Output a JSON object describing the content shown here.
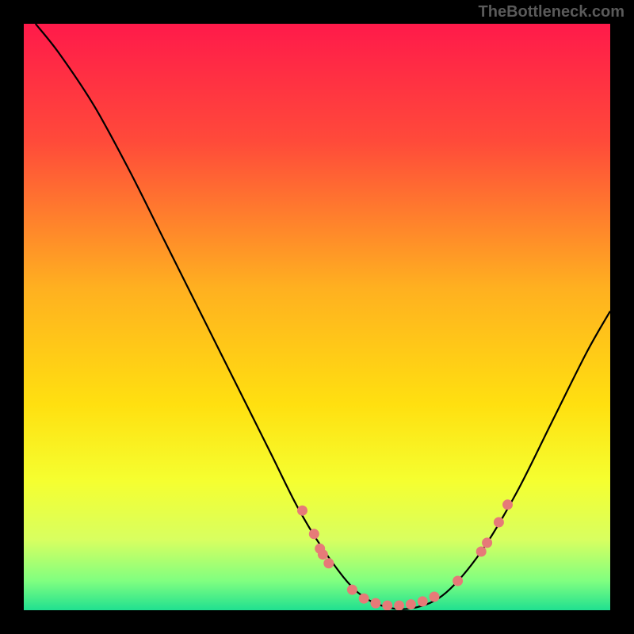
{
  "watermark": "TheBottleneck.com",
  "chart_data": {
    "type": "line",
    "title": "",
    "xlabel": "",
    "ylabel": "",
    "xlim": [
      0,
      100
    ],
    "ylim": [
      0,
      100
    ],
    "background_gradient": {
      "stops": [
        {
          "offset": 0,
          "color": "#ff1a4a"
        },
        {
          "offset": 20,
          "color": "#ff4a3a"
        },
        {
          "offset": 45,
          "color": "#ffb020"
        },
        {
          "offset": 65,
          "color": "#ffe010"
        },
        {
          "offset": 78,
          "color": "#f5ff30"
        },
        {
          "offset": 88,
          "color": "#d8ff60"
        },
        {
          "offset": 95,
          "color": "#80ff80"
        },
        {
          "offset": 100,
          "color": "#20e090"
        }
      ]
    },
    "series": [
      {
        "name": "bottleneck-curve",
        "type": "line",
        "color": "#000000",
        "points": [
          {
            "x": 2,
            "y": 100
          },
          {
            "x": 6,
            "y": 95
          },
          {
            "x": 12,
            "y": 86
          },
          {
            "x": 18,
            "y": 75
          },
          {
            "x": 24,
            "y": 63
          },
          {
            "x": 30,
            "y": 51
          },
          {
            "x": 36,
            "y": 39
          },
          {
            "x": 42,
            "y": 27
          },
          {
            "x": 47,
            "y": 17
          },
          {
            "x": 52,
            "y": 9
          },
          {
            "x": 57,
            "y": 3
          },
          {
            "x": 62,
            "y": 0.5
          },
          {
            "x": 67,
            "y": 0.5
          },
          {
            "x": 72,
            "y": 3
          },
          {
            "x": 78,
            "y": 10
          },
          {
            "x": 84,
            "y": 20
          },
          {
            "x": 90,
            "y": 32
          },
          {
            "x": 96,
            "y": 44
          },
          {
            "x": 100,
            "y": 51
          }
        ]
      },
      {
        "name": "highlight-dots",
        "type": "scatter",
        "color": "#e67a78",
        "points": [
          {
            "x": 47.5,
            "y": 17
          },
          {
            "x": 49.5,
            "y": 13
          },
          {
            "x": 50.5,
            "y": 10.5
          },
          {
            "x": 51,
            "y": 9.5
          },
          {
            "x": 52,
            "y": 8
          },
          {
            "x": 56,
            "y": 3.5
          },
          {
            "x": 58,
            "y": 2
          },
          {
            "x": 60,
            "y": 1.2
          },
          {
            "x": 62,
            "y": 0.8
          },
          {
            "x": 64,
            "y": 0.8
          },
          {
            "x": 66,
            "y": 1
          },
          {
            "x": 68,
            "y": 1.5
          },
          {
            "x": 70,
            "y": 2.3
          },
          {
            "x": 74,
            "y": 5
          },
          {
            "x": 78,
            "y": 10
          },
          {
            "x": 79,
            "y": 11.5
          },
          {
            "x": 81,
            "y": 15
          },
          {
            "x": 82.5,
            "y": 18
          }
        ]
      }
    ]
  }
}
